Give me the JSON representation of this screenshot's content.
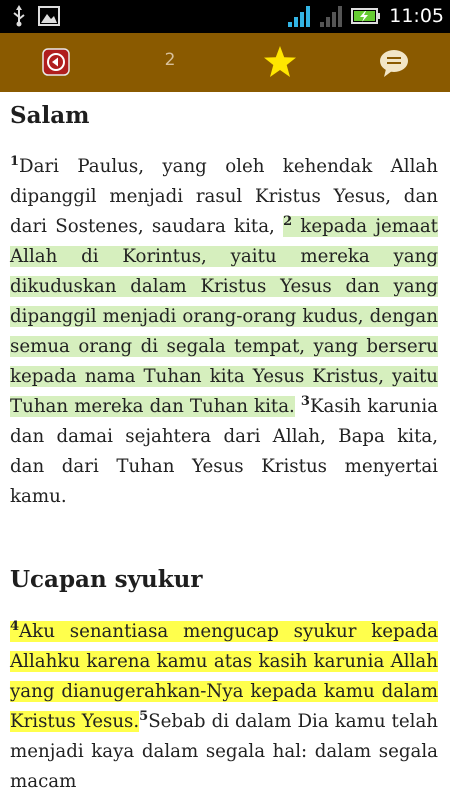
{
  "status_bar": {
    "time": "11:05",
    "icons": [
      "usb-icon",
      "image-icon",
      "wifi-icon",
      "signal-icon",
      "battery-charging-icon"
    ]
  },
  "toolbar": {
    "chapter": "2",
    "icons": [
      "back-arrow-icon",
      "star-icon",
      "comment-icon"
    ],
    "color": "#8a5a00"
  },
  "sections": [
    {
      "title": "Salam",
      "verses": [
        {
          "num": "1",
          "text": "Dari Paulus, yang oleh kehendak Allah dipanggil menjadi rasul Kristus Yesus, dan dari Sostenes, saudara kita, "
        },
        {
          "num": "2",
          "text": " kepada jemaat Allah di Korintus, yaitu mereka yang dikuduskan dalam Kristus Yesus dan yang dipanggil menjadi orang-orang kudus, dengan semua orang di segala tempat, yang berseru kepada nama Tuhan kita Yesus Kristus, yaitu Tuhan mereka dan Tuhan kita.",
          "highlight": "green"
        },
        {
          "num": "3",
          "text": "Kasih karunia dan damai sejahtera dari Allah, Bapa kita, dan dari Tuhan Yesus Kristus menyertai kamu."
        }
      ]
    },
    {
      "title": "Ucapan syukur",
      "verses": [
        {
          "num": "4",
          "text": "Aku senantiasa mengucap syukur kepada Allahku karena kamu atas kasih karunia Allah yang dianugerahkan-Nya kepada kamu dalam Kristus Yesus.",
          "highlight": "yellow"
        },
        {
          "num": "5",
          "text": "Sebab di dalam Dia kamu telah menjadi kaya dalam segala hal: dalam segala macam"
        }
      ]
    }
  ],
  "colors": {
    "green_highlight": "#d6efbe",
    "yellow_highlight": "#ffff4c"
  }
}
